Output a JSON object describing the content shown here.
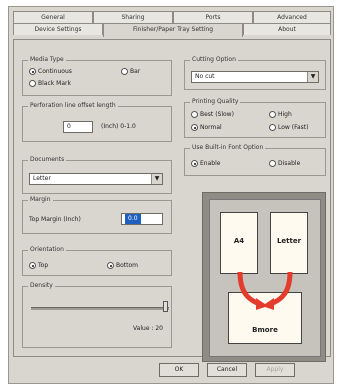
{
  "tabs_row1": [
    "General",
    "Sharing",
    "Ports",
    "Advanced"
  ],
  "tabs_row2": [
    "Device Settings",
    "Finisher/Paper Tray Setting",
    "About"
  ],
  "media": {
    "title": "Media Type",
    "opt1": "Continuous",
    "opt2": "Bar",
    "opt3": "Black Mark"
  },
  "perforation": {
    "title": "Perforation line offset length",
    "value": "0",
    "unit": "(Inch) 0-1.0"
  },
  "documents": {
    "title": "Documents",
    "value": "Letter"
  },
  "margin": {
    "title": "Margin",
    "label": "Top Margin (Inch)",
    "value": "0.0"
  },
  "orientation": {
    "title": "Orientation",
    "opt1": "Top",
    "opt2": "Bottom"
  },
  "density": {
    "title": "Density",
    "value_label": "Value : 20",
    "value": 20
  },
  "cutting": {
    "title": "Cutting Option",
    "value": "No cut"
  },
  "quality": {
    "title": "Printing Quality",
    "opt1": "Best (Slow)",
    "opt2": "High",
    "opt3": "Normal",
    "opt4": "Low (Fast)"
  },
  "font_opt": {
    "title": "Use Built-in Font Option",
    "opt1": "Enable",
    "opt2": "Disable"
  },
  "preview": {
    "paper1": "A4",
    "paper2": "Letter",
    "paper3": "Bmore"
  },
  "buttons": {
    "ok": "OK",
    "cancel": "Cancel",
    "apply": "Apply"
  },
  "colors": {
    "arrow": "#e33b2c",
    "selection": "#1f5fbf"
  }
}
